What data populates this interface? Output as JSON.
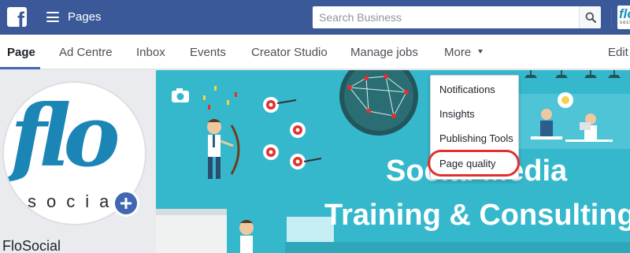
{
  "topbar": {
    "logo_icon": "facebook-f-icon",
    "menu_icon": "hamburger-icon",
    "title": "Pages",
    "search": {
      "placeholder": "Search Business",
      "value": ""
    },
    "search_icon": "search-icon",
    "avatar_text": "flo",
    "avatar_sub": "social"
  },
  "tabs": [
    {
      "label": "Page",
      "active": true
    },
    {
      "label": "Ad Centre"
    },
    {
      "label": "Inbox"
    },
    {
      "label": "Events"
    },
    {
      "label": "Creator Studio"
    },
    {
      "label": "Manage jobs"
    },
    {
      "label": "More",
      "caret_icon": "caret-down-icon"
    },
    {
      "label": "Edit"
    }
  ],
  "more_menu": {
    "items": [
      {
        "label": "Notifications"
      },
      {
        "label": "Insights"
      },
      {
        "label": "Publishing Tools"
      },
      {
        "label": "Page quality",
        "highlighted": true
      }
    ],
    "highlight_color": "#e2302e"
  },
  "profile": {
    "logo_text": "flo",
    "logo_sub": "social",
    "add_icon": "plus-icon",
    "page_name": "FloSocial"
  },
  "cover": {
    "line1": "Social Media",
    "line2": "Training & Consulting"
  },
  "colors": {
    "facebook_blue": "#3b5998",
    "active_tab_underline": "#4267b2",
    "cover_bg": "#35b8cc",
    "brand_blue": "#1b85b6"
  }
}
